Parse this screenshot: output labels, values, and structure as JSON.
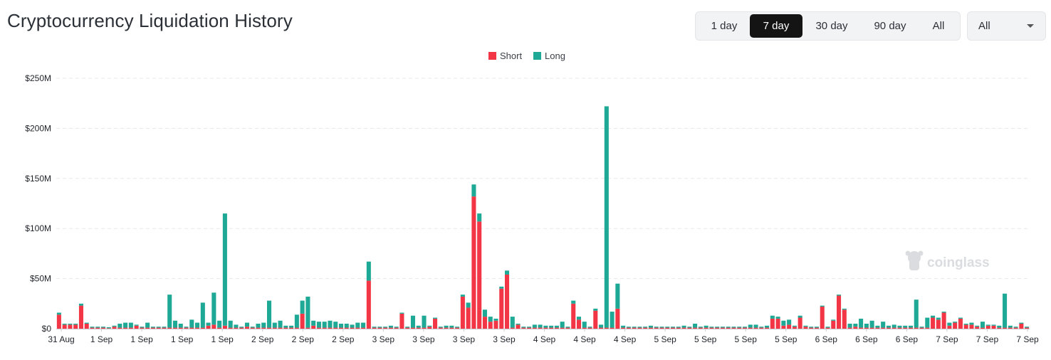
{
  "header": {
    "title": "Cryptocurrency Liquidation History"
  },
  "range_selector": {
    "options": [
      "1 day",
      "7 day",
      "30 day",
      "90 day",
      "All"
    ],
    "active": "7 day"
  },
  "coin_select": {
    "value": "All"
  },
  "watermark": "coinglass",
  "colors": {
    "short": "#f23645",
    "long": "#1ea896"
  },
  "chart_data": {
    "type": "bar",
    "stacked": true,
    "legend": [
      "Short",
      "Long"
    ],
    "legend_position": "top-center",
    "grid": true,
    "y_ticks": [
      "$0",
      "$50M",
      "$100M",
      "$150M",
      "$200M",
      "$250M"
    ],
    "ylim": [
      0,
      250
    ],
    "y_unit": "$M",
    "x_tick_labels": [
      "31 Aug",
      "1 Sep",
      "1 Sep",
      "1 Sep",
      "1 Sep",
      "2 Sep",
      "2 Sep",
      "2 Sep",
      "3 Sep",
      "3 Sep",
      "3 Sep",
      "3 Sep",
      "4 Sep",
      "4 Sep",
      "4 Sep",
      "5 Sep",
      "5 Sep",
      "5 Sep",
      "5 Sep",
      "6 Sep",
      "6 Sep",
      "6 Sep",
      "7 Sep",
      "7 Sep",
      "7 Sep"
    ],
    "series": [
      {
        "name": "Short",
        "values": [
          14,
          4,
          4,
          4,
          23,
          5,
          1,
          1,
          1,
          0.5,
          2,
          1,
          1,
          1,
          3,
          1,
          1,
          1,
          1,
          1,
          1,
          1,
          1,
          1,
          1,
          1,
          1,
          3,
          4,
          1,
          3,
          1,
          1,
          1,
          2,
          1,
          1,
          1,
          1,
          1,
          1,
          1,
          1,
          1,
          15,
          1,
          3,
          1,
          1,
          1,
          1,
          1,
          1,
          1,
          1,
          1,
          48,
          1,
          1,
          1,
          1,
          1,
          15,
          1,
          1,
          1,
          1,
          2,
          10,
          1,
          1,
          1,
          1,
          32,
          21,
          132,
          107,
          12,
          7,
          8,
          40,
          54,
          1,
          4,
          1,
          1,
          1,
          1,
          1,
          1,
          1,
          1,
          1,
          25,
          9,
          1,
          1,
          18,
          1,
          1,
          1,
          20,
          1,
          1,
          1,
          1,
          1,
          1,
          1,
          1,
          1,
          1,
          1,
          1,
          1,
          1,
          1,
          1,
          1,
          1,
          1,
          1,
          1,
          1,
          1,
          1,
          1,
          1,
          1,
          10,
          10,
          3,
          4,
          2,
          11,
          2,
          1,
          1,
          22,
          1,
          8,
          33,
          19,
          1,
          2,
          1,
          1,
          1,
          1,
          1,
          1,
          1,
          1,
          1,
          1,
          1,
          1,
          1,
          11,
          9,
          16,
          3,
          6,
          10,
          4,
          4,
          2,
          1,
          3,
          3,
          1,
          1,
          1,
          1,
          5,
          1
        ],
        "long": [
          2,
          1,
          1,
          1,
          2,
          1,
          1,
          1,
          1,
          1,
          1,
          4,
          5,
          5,
          1,
          1,
          5,
          1,
          1,
          1,
          33,
          7,
          4,
          1,
          8,
          5,
          25,
          3,
          32,
          7,
          112,
          7,
          3,
          1,
          4,
          1,
          4,
          5,
          27,
          5,
          7,
          2,
          2,
          13,
          13,
          31,
          5,
          6,
          6,
          7,
          6,
          4,
          4,
          3,
          5,
          5,
          19,
          1,
          1,
          1,
          2,
          1,
          1,
          1,
          12,
          2,
          12,
          1,
          1,
          1,
          2,
          2,
          1,
          2,
          5,
          12,
          8,
          7,
          5,
          2,
          2,
          4,
          11,
          1,
          1,
          1,
          3,
          3,
          2,
          2,
          2,
          6,
          1,
          3,
          3,
          6,
          1,
          2,
          3,
          221,
          16,
          25,
          2,
          1,
          1,
          1,
          1,
          2,
          1,
          1,
          1,
          1,
          1,
          2,
          1,
          4,
          1,
          2,
          1,
          1,
          1,
          1,
          1,
          1,
          1,
          3,
          3,
          1,
          2,
          3,
          2,
          5,
          5,
          1,
          2,
          1,
          1,
          1,
          1,
          1,
          1,
          1,
          1,
          4,
          3,
          9,
          4,
          7,
          2,
          6,
          2,
          3,
          2,
          2,
          2,
          28,
          1,
          10,
          2,
          2,
          1,
          3,
          1,
          1,
          1,
          2,
          1,
          6,
          1,
          1,
          2,
          34,
          2,
          1,
          1,
          1,
          1,
          2,
          1
        ]
      }
    ]
  }
}
